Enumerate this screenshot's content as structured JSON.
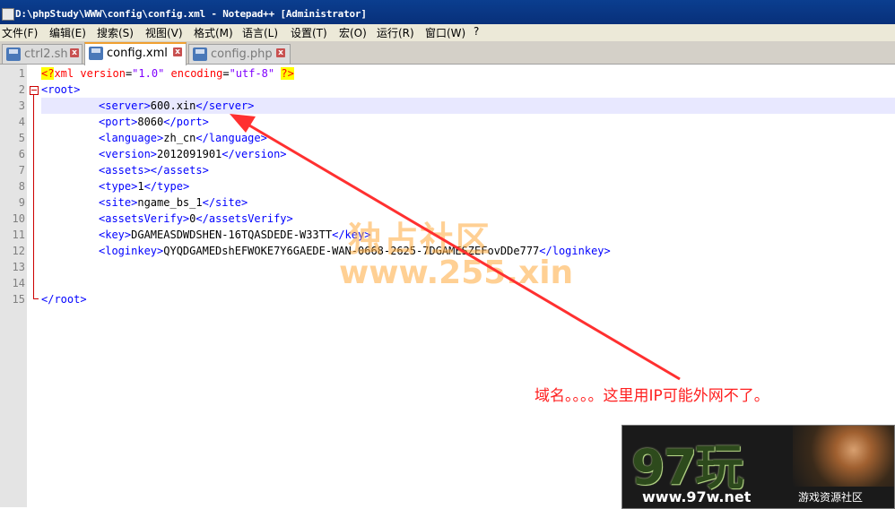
{
  "window": {
    "title": "D:\\phpStudy\\WWW\\config\\config.xml - Notepad++ [Administrator]"
  },
  "menu": [
    "文件(F)",
    "编辑(E)",
    "搜索(S)",
    "视图(V)",
    "格式(M)",
    "语言(L)",
    "设置(T)",
    "宏(O)",
    "运行(R)",
    "窗口(W)",
    "?"
  ],
  "tabs": [
    {
      "label": "ctrl2.sh",
      "active": false
    },
    {
      "label": "config.xml",
      "active": true
    },
    {
      "label": "config.php",
      "active": false
    }
  ],
  "editor": {
    "line_numbers": [
      "1",
      "2",
      "3",
      "4",
      "5",
      "6",
      "7",
      "8",
      "9",
      "10",
      "11",
      "12",
      "13",
      "14",
      "15"
    ],
    "lines": {
      "l1_open": "<?",
      "l1_xml": "xml ",
      "l1_a1": "version",
      "l1_eq1": "=",
      "l1_v1": "\"1.0\"",
      "l1_a2": " encoding",
      "l1_eq2": "=",
      "l1_v2": "\"utf-8\"",
      "l1_close": "?>",
      "l2": "<root>",
      "server_open": "<server>",
      "server_val": "600.xin",
      "server_close": "</server>",
      "port_open": "<port>",
      "port_val": "8060",
      "port_close": "</port>",
      "language_open": "<language>",
      "language_val": "zh_cn",
      "language_close": "</language>",
      "version_open": "<version>",
      "version_val": "2012091901",
      "version_close": "</version>",
      "assets_open": "<assets>",
      "assets_close": "</assets>",
      "type_open": "<type>",
      "type_val": "1",
      "type_close": "</type>",
      "site_open": "<site>",
      "site_val": "ngame_bs_1",
      "site_close": "</site>",
      "assetsVerify_open": "<assetsVerify>",
      "assetsVerify_val": "0",
      "assetsVerify_close": "</assetsVerify>",
      "key_open": "<key>",
      "key_val": "DGAMEASDWDSHEN-16TQASDEDE-W33TT",
      "key_close": "</key>",
      "loginkey_open": "<loginkey>",
      "loginkey_val": "QYQDGAMEDshEFWOKE7Y6GAEDE-WAN-0668-2625-7DGAMESZEFovDDe777",
      "loginkey_close": "</loginkey>",
      "root_close": "</root>"
    }
  },
  "annotation": "域名。。。。这里用IP可能外网不了。",
  "watermark": {
    "line1": "独占社区",
    "line2": "www.255.xin"
  },
  "badge": {
    "big": "97玩",
    "url": "www.97w.net",
    "sub": "游戏资源社区"
  },
  "colors": {
    "tag": "#0000ff",
    "attr": "#ff0000",
    "value": "#8000ff",
    "arrow": "#ff3030"
  }
}
